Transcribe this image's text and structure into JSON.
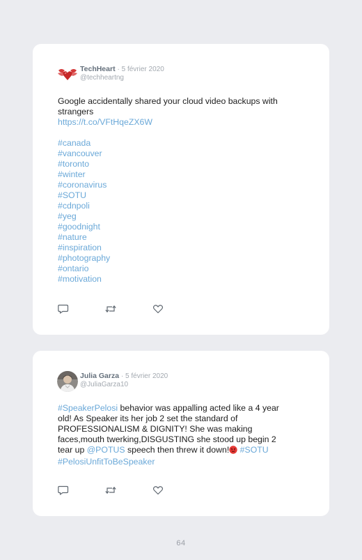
{
  "posts": [
    {
      "name": "TechHeart",
      "date": "· 5 février 2020",
      "handle": "@techheartng",
      "text_lines": [
        "Google accidentally shared your cloud video backups with",
        "strangers"
      ],
      "link": "https://t.co/VFtHqeZX6W",
      "hashtags": [
        "#canada",
        "#vancouver",
        "#toronto",
        "#winter",
        "#coronavirus",
        "#SOTU",
        "#cdnpoli",
        "#yeg",
        "#goodnight",
        "#nature",
        "#inspiration",
        "#photography",
        "#ontario",
        "#motivation"
      ],
      "avatar_icon": "heart-wings-logo"
    },
    {
      "name": "Julia Garza",
      "date": "· 5 février 2020",
      "handle": "@JuliaGarza10",
      "lines": [
        {
          "hashtag": "#SpeakerPelosi",
          "text": " behavior was appalling acted like a 4 year"
        },
        {
          "text": "old! As Speaker its her job 2 set the standard of"
        },
        {
          "text": "PROFESSIONALISM & DIGNITY! She was making"
        },
        {
          "text": "faces,mouth twerking,DISGUSTING she stood up begin 2"
        },
        {
          "text_before": "tear up ",
          "mention": "@POTUS",
          "text_after": " speech then threw it down!",
          "emoji": "angry-face-emoji",
          "hashtag_after": " #SOTU"
        },
        {
          "hashtag": "#PelosiUnfitToBeSpeaker"
        }
      ],
      "avatar_icon": "profile-photo"
    }
  ],
  "actions": {
    "reply_icon": "reply-icon",
    "retweet_icon": "retweet-icon",
    "like_icon": "heart-icon"
  },
  "colors": {
    "background": "#ebecf0",
    "card": "#ffffff",
    "link": "#6aa8d8",
    "text": "#1c1c1c",
    "muted": "#a3a9b0"
  },
  "page_number": "64"
}
